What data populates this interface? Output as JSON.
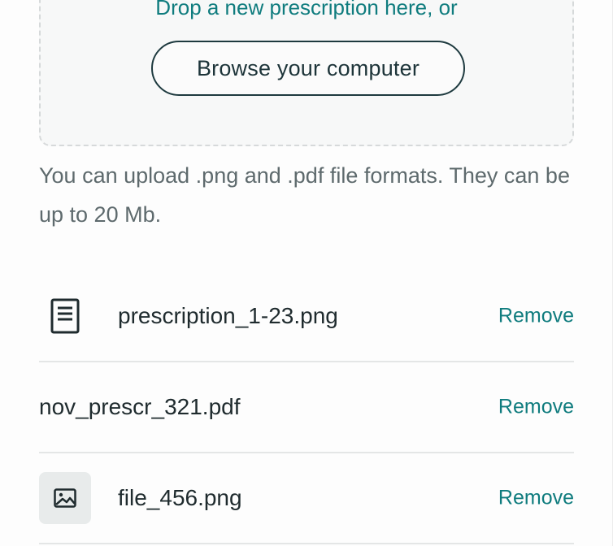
{
  "dropzone": {
    "prompt": "Drop a new prescription here, or",
    "browse_label": "Browse your computer"
  },
  "help": {
    "text": "You can upload .png and .pdf file formats. They can be up to 20 Mb."
  },
  "files": [
    {
      "name": "prescription_1-23.png",
      "icon": "document-icon",
      "remove_label": "Remove"
    },
    {
      "name": "nov_prescr_321.pdf",
      "icon": "",
      "remove_label": "Remove"
    },
    {
      "name": "file_456.png",
      "icon": "image-icon",
      "remove_label": "Remove"
    }
  ],
  "colors": {
    "accent": "#0f7c7e",
    "text": "#1f2b2e",
    "muted": "#5e6a6d",
    "border": "#d6d9da"
  }
}
